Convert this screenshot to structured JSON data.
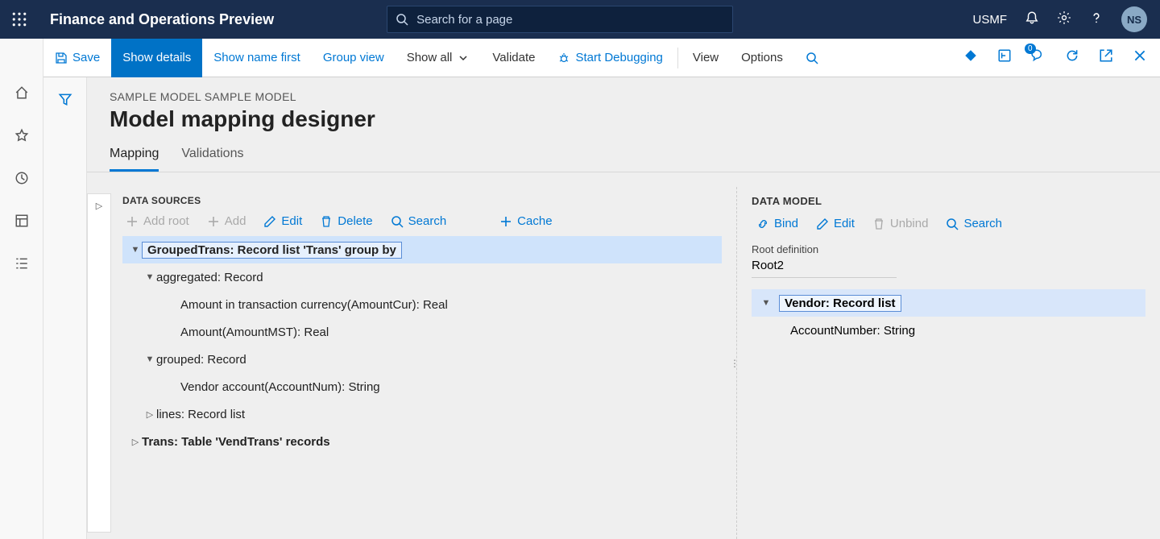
{
  "topbar": {
    "title": "Finance and Operations Preview",
    "search_placeholder": "Search for a page",
    "entity": "USMF",
    "avatar_initials": "NS"
  },
  "actionpane": {
    "save": "Save",
    "show_details": "Show details",
    "show_name_first": "Show name first",
    "group_view": "Group view",
    "show_all": "Show all",
    "validate": "Validate",
    "start_debugging": "Start Debugging",
    "view": "View",
    "options": "Options",
    "badge_count": "0"
  },
  "page": {
    "breadcrumb": "SAMPLE MODEL SAMPLE MODEL",
    "title": "Model mapping designer",
    "tabs": {
      "mapping": "Mapping",
      "validations": "Validations"
    }
  },
  "ds": {
    "heading": "DATA SOURCES",
    "toolbar": {
      "add_root": "Add root",
      "add": "Add",
      "edit": "Edit",
      "delete": "Delete",
      "search": "Search",
      "cache": "Cache"
    },
    "tree": {
      "n1": "GroupedTrans: Record list 'Trans' group by",
      "n1a": "aggregated: Record",
      "n1a1": "Amount in transaction currency(AmountCur): Real",
      "n1a2": "Amount(AmountMST): Real",
      "n1b": "grouped: Record",
      "n1b1": "Vendor account(AccountNum): String",
      "n1c": "lines: Record list",
      "n2": "Trans: Table 'VendTrans' records"
    }
  },
  "dm": {
    "heading": "DATA MODEL",
    "toolbar": {
      "bind": "Bind",
      "edit": "Edit",
      "unbind": "Unbind",
      "search": "Search"
    },
    "root_label": "Root definition",
    "root_value": "Root2",
    "tree": {
      "n1": "Vendor: Record list",
      "n1a": "AccountNumber: String"
    }
  }
}
